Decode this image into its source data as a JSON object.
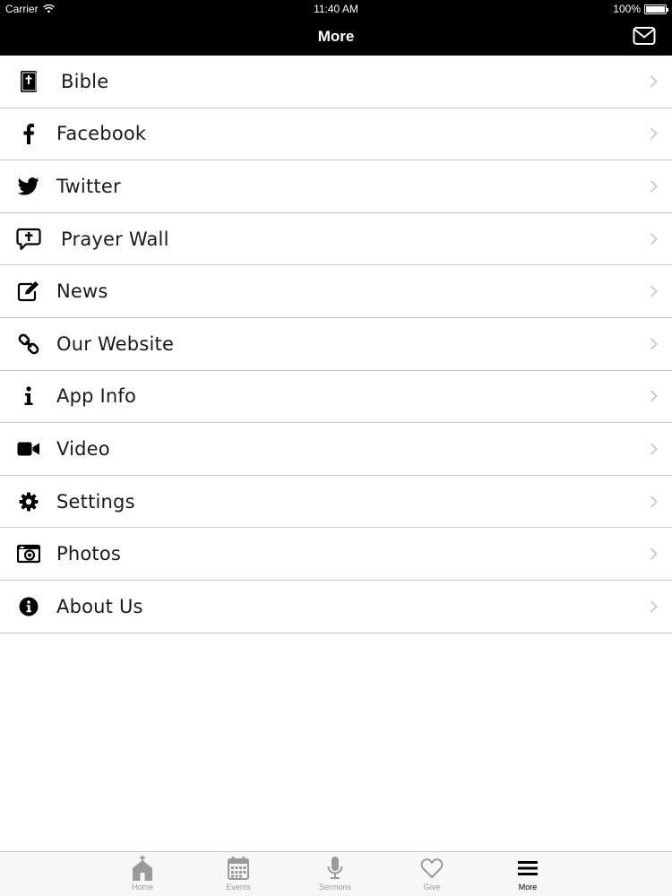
{
  "status": {
    "carrier": "Carrier",
    "time": "11:40 AM",
    "battery": "100%",
    "battery_level": 1.0
  },
  "nav": {
    "title": "More",
    "action_icon": "mail-icon"
  },
  "menu": [
    {
      "label": "Bible",
      "icon": "bible-icon"
    },
    {
      "label": "Facebook",
      "icon": "facebook-icon"
    },
    {
      "label": "Twitter",
      "icon": "twitter-icon"
    },
    {
      "label": "Prayer Wall",
      "icon": "prayer-chat-icon"
    },
    {
      "label": "News",
      "icon": "edit-icon"
    },
    {
      "label": "Our Website",
      "icon": "link-icon"
    },
    {
      "label": "App Info",
      "icon": "info-icon"
    },
    {
      "label": "Video",
      "icon": "video-camera-icon"
    },
    {
      "label": "Settings",
      "icon": "gear-icon"
    },
    {
      "label": "Photos",
      "icon": "camera-icon"
    },
    {
      "label": "About Us",
      "icon": "info-circle-icon"
    }
  ],
  "tabs": [
    {
      "label": "Home",
      "icon": "church-icon",
      "active": false
    },
    {
      "label": "Events",
      "icon": "calendar-icon",
      "active": false
    },
    {
      "label": "Sermons",
      "icon": "microphone-icon",
      "active": false
    },
    {
      "label": "Give",
      "icon": "heart-icon",
      "active": false
    },
    {
      "label": "More",
      "icon": "menu-icon",
      "active": true
    }
  ]
}
